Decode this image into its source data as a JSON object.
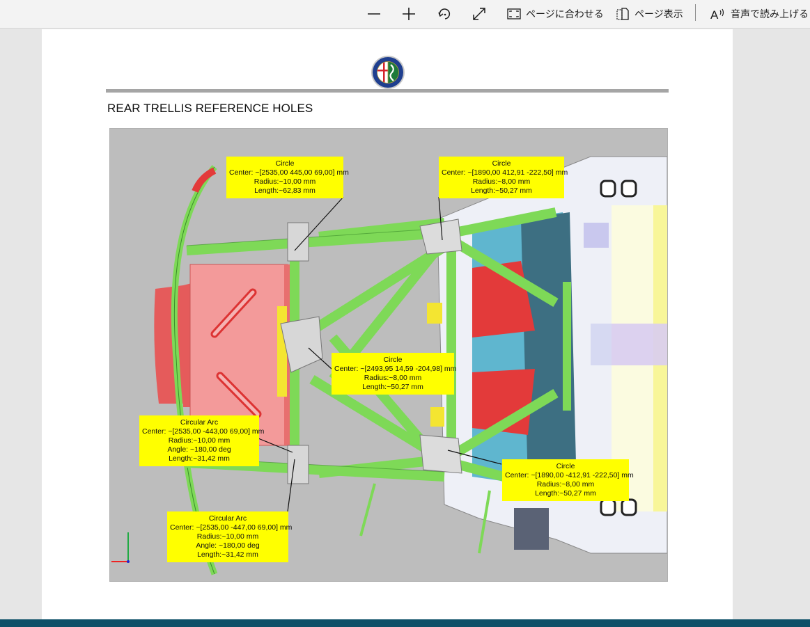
{
  "toolbar": {
    "zoom_out_icon": "minus-icon",
    "zoom_in_icon": "plus-icon",
    "rotate_icon": "rotate-icon",
    "fullscreen_icon": "expand-icon",
    "fit_page_label": "ページに合わせる",
    "page_view_label": "ページ表示",
    "read_aloud_label": "音声で読み上げる"
  },
  "document": {
    "section_title": "REAR TRELLIS REFERENCE HOLES",
    "callouts": [
      {
        "title": "Circle",
        "lines": [
          "Center: ~[2535,00 445,00 69,00] mm",
          "Radius:~10,00 mm",
          "Length:~62,83 mm"
        ]
      },
      {
        "title": "Circle",
        "lines": [
          "Center: ~[1890,00 412,91 -222,50] mm",
          "Radius:~8,00 mm",
          "Length:~50,27 mm"
        ]
      },
      {
        "title": "Circle",
        "lines": [
          "Center: ~[2493,95 14,59 -204,98] mm",
          "Radius:~8,00 mm",
          "Length:~50,27 mm"
        ]
      },
      {
        "title": "Circular Arc",
        "lines": [
          "Center: ~[2535,00 -443,00 69,00] mm",
          "Radius:~10,00 mm",
          "Angle: ~180,00 deg",
          "Length:~31,42 mm"
        ]
      },
      {
        "title": "Circle",
        "lines": [
          "Center: ~[1890,00 -412,91 -222,50] mm",
          "Radius:~8,00 mm",
          "Length:~50,27 mm"
        ]
      },
      {
        "title": "Circular Arc",
        "lines": [
          "Center: ~[2535,00 -447,00 69,00] mm",
          "Radius:~10,00 mm",
          "Angle: ~180,00 deg",
          "Length:~31,42 mm"
        ]
      }
    ]
  },
  "colors": {
    "callout_bg": "#ffff00",
    "frame_green": "#7ed957",
    "plate_red": "#f08a8a",
    "figure_bg": "#bdbdbd"
  }
}
